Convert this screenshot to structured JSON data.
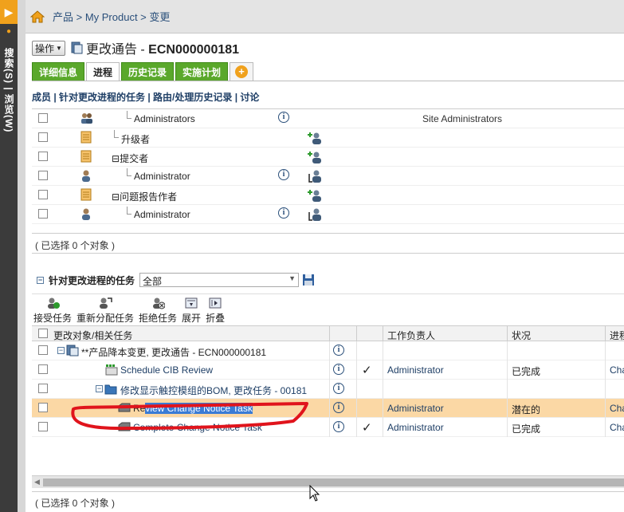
{
  "left_rail": {
    "text": "搜索(S) | 浏览(W)"
  },
  "breadcrumb": {
    "text": "产品 > My Product > 变更"
  },
  "header": {
    "action_label": "操作",
    "title_prefix": "更改通告 - ",
    "title_number": "ECN000000181"
  },
  "tabs": [
    {
      "label": "详细信息",
      "active": false
    },
    {
      "label": "进程",
      "active": true
    },
    {
      "label": "历史记录",
      "active": false
    },
    {
      "label": "实施计划",
      "active": false
    }
  ],
  "sublinks": "成员 | 针对更改进程的任务 | 路由/处理历史记录 | 讨论",
  "upper_rows": [
    {
      "icon": "group-icon",
      "name": "Administrators",
      "indent": 2,
      "info": true,
      "action": "",
      "extra": "Site Administrators"
    },
    {
      "icon": "role-icon",
      "name": "升级者",
      "indent": 1,
      "info": false,
      "action": "add-participant-icon",
      "extra": ""
    },
    {
      "icon": "role-icon",
      "name": "提交者",
      "indent": 1,
      "expand": "⊟",
      "info": false,
      "action": "add-participant-icon",
      "extra": ""
    },
    {
      "icon": "user-icon",
      "name": "Administrator",
      "indent": 2,
      "info": true,
      "action": "remove-participant-icon",
      "extra": ""
    },
    {
      "icon": "role-icon",
      "name": "问题报告作者",
      "indent": 1,
      "expand": "⊟",
      "info": false,
      "action": "add-participant-icon",
      "extra": ""
    },
    {
      "icon": "user-icon",
      "name": "Administrator",
      "indent": 2,
      "info": true,
      "action": "remove-participant-icon",
      "extra": ""
    }
  ],
  "status_upper": "( 已选择 0 个对象 )",
  "tasks_section": {
    "title": "针对更改进程的任务",
    "filter_value": "全部"
  },
  "toolbar": [
    {
      "label": "接受任务",
      "icon": "accept-task-icon"
    },
    {
      "label": "重新分配任务",
      "icon": "reassign-task-icon"
    },
    {
      "label": "拒绝任务",
      "icon": "reject-task-icon"
    },
    {
      "label": "展开",
      "icon": "expand-icon"
    },
    {
      "label": "折叠",
      "icon": "collapse-icon"
    }
  ],
  "lower_columns": {
    "object": "更改对象/相关任务",
    "owner": "工作负责人",
    "state": "状况",
    "process": "进程"
  },
  "lower_rows": [
    {
      "name": "**产品降本变更, 更改通告 - ECN000000181",
      "owner": "",
      "state": "",
      "process": "",
      "check": false
    },
    {
      "name": "Schedule CIB Review",
      "owner": "Administrator",
      "state": "已完成",
      "process": "Cha",
      "check": true
    },
    {
      "name": "修改显示触控模组的BOM, 更改任务 - 00181",
      "owner": "",
      "state": "",
      "process": "",
      "check": false
    },
    {
      "name_a": "Re",
      "name_b": "view Change Notice Task",
      "owner": "Administrator",
      "state": "潜在的",
      "process": "Cha",
      "check": false
    },
    {
      "name": "Complete Change Notice Task",
      "owner": "Administrator",
      "state": "已完成",
      "process": "Cha",
      "check": true
    }
  ],
  "status_lower": "( 已选择 0 个对象 )",
  "info_glyph": "i",
  "check_glyph": "✓",
  "colors": {
    "tab_green": "#5aa82b",
    "selected_row": "#fbd8a5",
    "annotation_red": "#e0141c",
    "rail_orange": "#f0a11c"
  }
}
